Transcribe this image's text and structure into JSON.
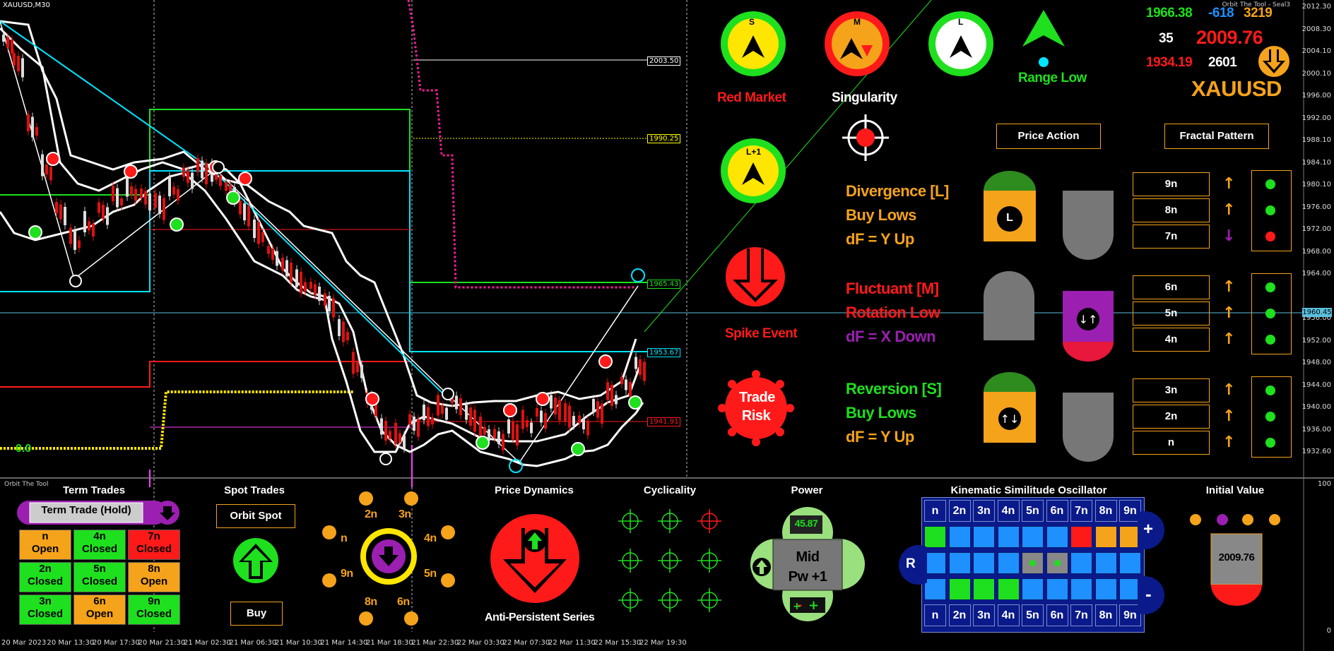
{
  "window": {
    "symbol_title": "XAUUSD,M30",
    "indicator_name": "Orbit The Tool - Seal3",
    "sub_window_label": "Orbit The Tool"
  },
  "price_axis": [
    "2012.30",
    "2008.30",
    "2004.10",
    "2000.10",
    "1996.00",
    "1992.00",
    "1988.10",
    "1984.10",
    "1980.10",
    "1976.00",
    "1972.00",
    "1968.00",
    "1964.00",
    "1960.45",
    "1956.00",
    "1952.00",
    "1948.00",
    "1944.00",
    "1940.00",
    "1936.00",
    "1932.60"
  ],
  "sub_axis": {
    "top": "100",
    "bottom": "0"
  },
  "time_axis": [
    "20 Mar 2023",
    "20 Mar 13:30",
    "20 Mar 17:30",
    "20 Mar 21:30",
    "21 Mar 02:30",
    "21 Mar 06:30",
    "21 Mar 10:30",
    "21 Mar 14:30",
    "21 Mar 18:30",
    "21 Mar 22:30",
    "22 Mar 03:30",
    "22 Mar 07:30",
    "22 Mar 11:30",
    "22 Mar 15:30",
    "22 Mar 19:30"
  ],
  "price_tags": {
    "p2003": "2003.50",
    "p1990": "1990.25",
    "p1965": "1965.43",
    "p1953": "1953.67",
    "p1941": "1941.91",
    "zero_label": "0.0"
  },
  "stats": {
    "val1": "1966.38",
    "val2": "-618",
    "val3": "3219",
    "val4": "35",
    "price": "2009.76",
    "val5": "1934.19",
    "val6": "2601",
    "symbol": "XAUUSD"
  },
  "circles": {
    "s": "S",
    "m": "M",
    "l": "L",
    "l1": "L+1"
  },
  "labels": {
    "red_market": "Red Market",
    "singularity": "Singularity",
    "range_low": "Range Low",
    "spike_event": "Spike Event",
    "trade_risk_1": "Trade",
    "trade_risk_2": "Risk",
    "price_action": "Price Action",
    "fractal_pattern": "Fractal Pattern"
  },
  "groups": {
    "l": {
      "title": "Divergence [L]",
      "line2": "Buy Lows",
      "line3": "dF = Y Up",
      "title_color": "#f5a31a",
      "line2_color": "#f5a31a",
      "line3_color": "#f5a31a",
      "badge": "L"
    },
    "m": {
      "title": "Fluctuant [M]",
      "line2": "Rotation Low",
      "line3": "dF = X Down",
      "title_color": "#ff1a1a",
      "line2_color": "#ff1a1a",
      "line3_color": "#9b1fb0"
    },
    "s": {
      "title": "Reversion [S]",
      "line2": "Buy Lows",
      "line3": "dF = Y Up",
      "title_color": "#1ee01e",
      "line2_color": "#1ee01e",
      "line3_color": "#f5a31a"
    }
  },
  "fractal_rows": [
    {
      "label": "9n",
      "arrow": "up",
      "dot": "green"
    },
    {
      "label": "8n",
      "arrow": "up",
      "dot": "green"
    },
    {
      "label": "7n",
      "arrow": "down",
      "dot": "red"
    },
    {
      "label": "6n",
      "arrow": "up",
      "dot": "green"
    },
    {
      "label": "5n",
      "arrow": "up",
      "dot": "green"
    },
    {
      "label": "4n",
      "arrow": "up",
      "dot": "green"
    },
    {
      "label": "3n",
      "arrow": "up",
      "dot": "green"
    },
    {
      "label": "2n",
      "arrow": "up",
      "dot": "green"
    },
    {
      "label": "n",
      "arrow": "up",
      "dot": "green"
    }
  ],
  "term_trades": {
    "title": "Term Trades",
    "button": "Term Trade (Hold)",
    "cells": [
      {
        "n": "n",
        "s": "Open",
        "color": "#f5a31a"
      },
      {
        "n": "4n",
        "s": "Closed",
        "color": "#1ee01e"
      },
      {
        "n": "7n",
        "s": "Closed",
        "color": "#ff1a1a"
      },
      {
        "n": "2n",
        "s": "Closed",
        "color": "#1ee01e"
      },
      {
        "n": "5n",
        "s": "Closed",
        "color": "#1ee01e"
      },
      {
        "n": "8n",
        "s": "Open",
        "color": "#f5a31a"
      },
      {
        "n": "3n",
        "s": "Closed",
        "color": "#1ee01e"
      },
      {
        "n": "6n",
        "s": "Open",
        "color": "#f5a31a"
      },
      {
        "n": "9n",
        "s": "Closed",
        "color": "#1ee01e"
      }
    ]
  },
  "spot_trades": {
    "title": "Spot Trades",
    "orbit_spot": "Orbit Spot",
    "buy": "Buy"
  },
  "orbit_labels": {
    "n2": "2n",
    "n3": "3n",
    "n": "n",
    "n4": "4n",
    "n9": "9n",
    "n5": "5n",
    "n8": "8n",
    "n6": "6n"
  },
  "price_dynamics": {
    "title": "Price Dynamics",
    "subtitle": "Anti-Persistent Series"
  },
  "cyclicality": {
    "title": "Cyclicality"
  },
  "power": {
    "title": "Power",
    "value": "45.87",
    "line1": "Mid",
    "line2": "Pw +1"
  },
  "kso": {
    "title": "Kinematic Similitude Oscillator",
    "headers": [
      "n",
      "2n",
      "3n",
      "4n",
      "5n",
      "6n",
      "7n",
      "8n",
      "9n"
    ],
    "row1": [
      "#1ee01e",
      "#1e90ff",
      "#1e90ff",
      "#1e90ff",
      "#1e90ff",
      "#1e90ff",
      "#ff1a1a",
      "#f5a31a",
      "#f5a31a"
    ],
    "row2": [
      "#1e90ff",
      "#1e90ff",
      "#1e90ff",
      "#1e90ff",
      "#888888",
      "#888888",
      "#1e90ff",
      "#1e90ff",
      "#1e90ff"
    ],
    "row3": [
      "#1e90ff",
      "#1ee01e",
      "#1ee01e",
      "#1ee01e",
      "#1e90ff",
      "#1e90ff",
      "#1e90ff",
      "#1e90ff",
      "#1e90ff"
    ],
    "plus": "+",
    "minus": "-",
    "r": "R"
  },
  "initial_value": {
    "title": "Initial Value",
    "value": "2009.76"
  }
}
